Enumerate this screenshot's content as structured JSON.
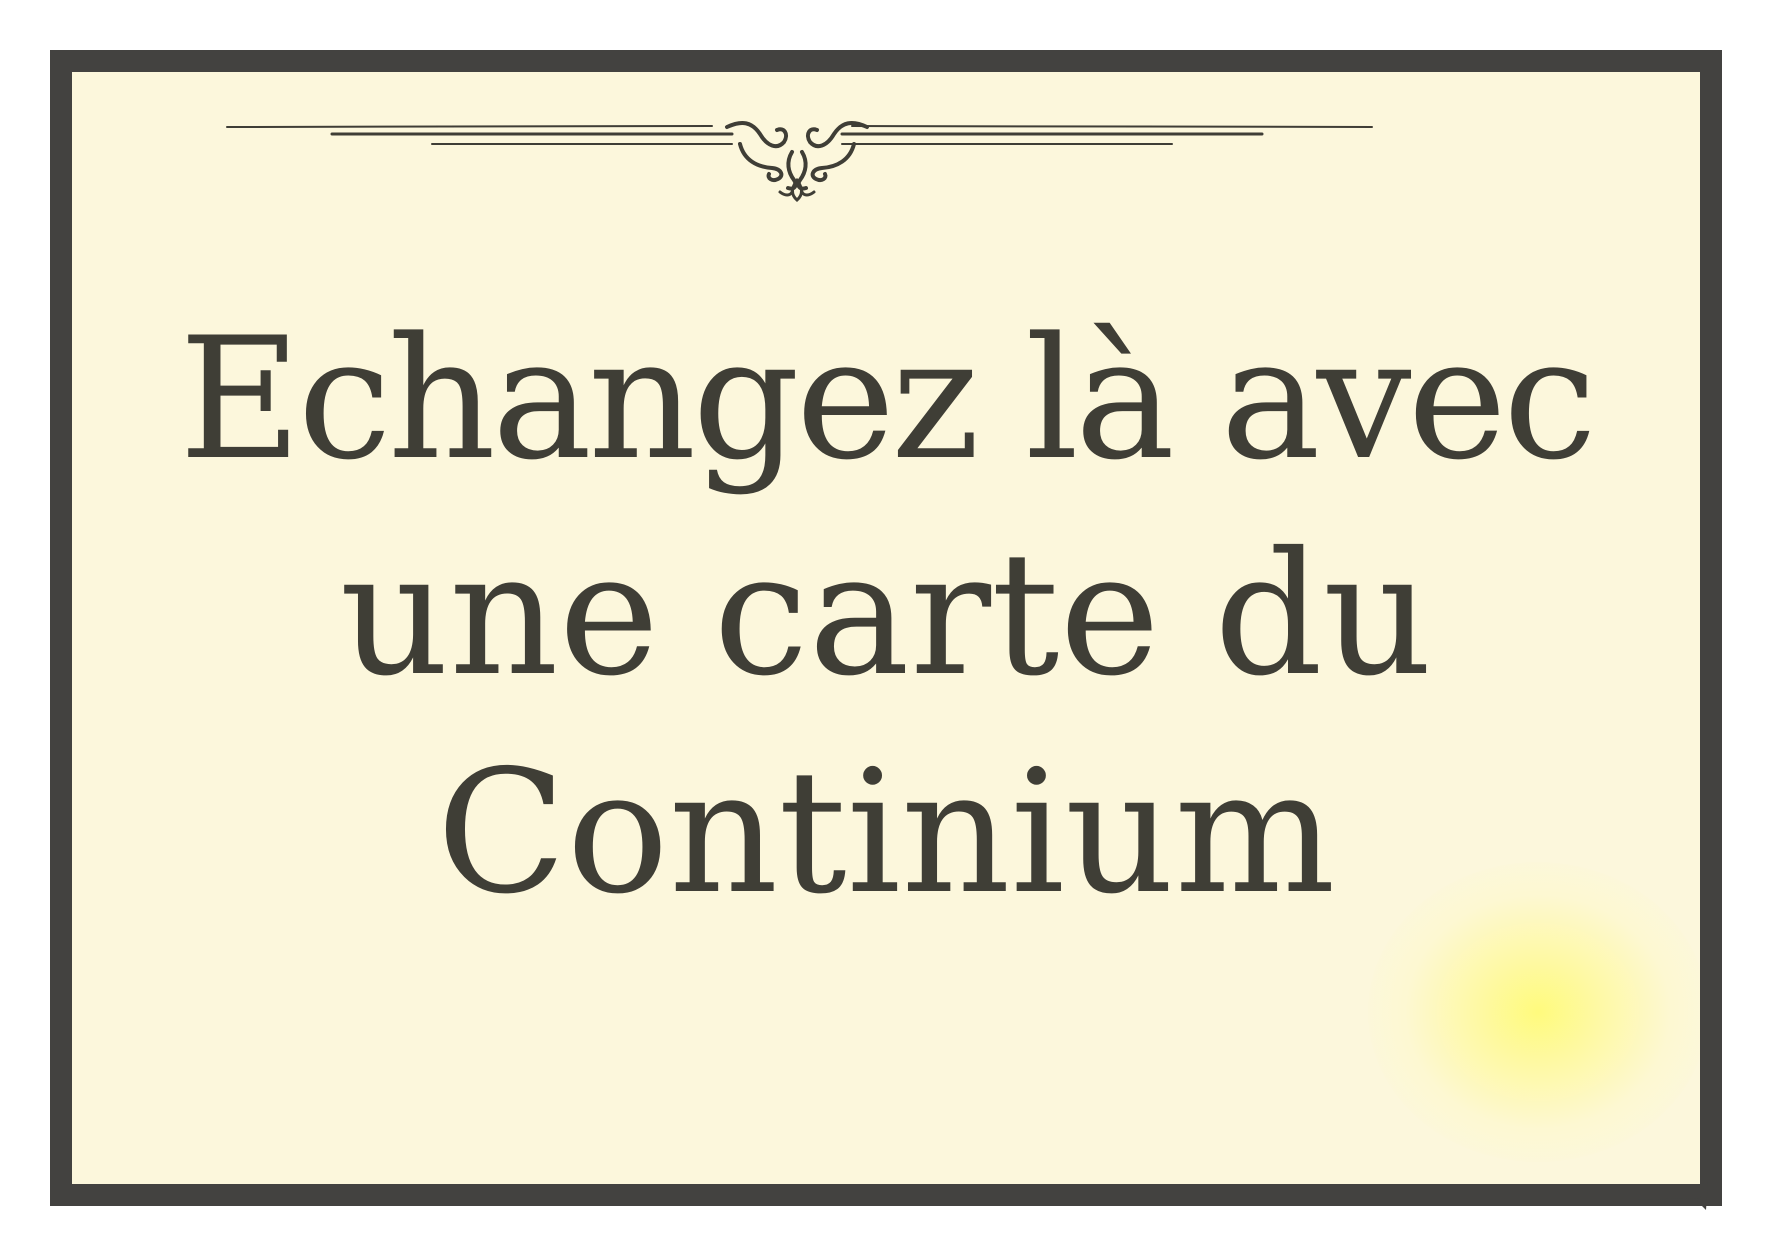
{
  "card": {
    "message_lines": [
      "Echangez là avec",
      "une carte du",
      "Continium"
    ],
    "ornament_icon": "flourish-divider-icon",
    "colors": {
      "background": "#fcf7dc",
      "frame": "#434240",
      "text": "#3f3e36",
      "glow": "#fff98a"
    }
  }
}
